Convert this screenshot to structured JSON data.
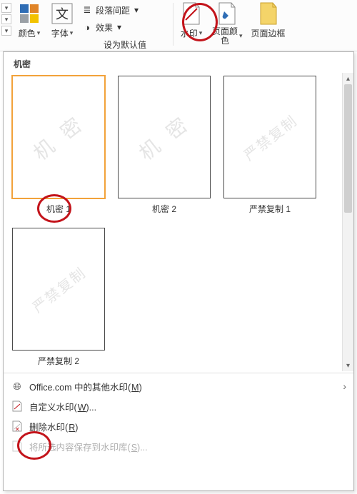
{
  "ribbon": {
    "color_label": "颜色",
    "font_label": "字体",
    "paragraph_spacing": "段落间距",
    "effects": "效果",
    "set_default": "设为默认值",
    "watermark": "水印",
    "page_color": "页面颜\n色",
    "page_border": "页面边框"
  },
  "panel": {
    "section_title": "机密",
    "items": [
      {
        "watermark_text": "机 密",
        "label": "机密 1",
        "selected": true
      },
      {
        "watermark_text": "机 密",
        "label": "机密 2",
        "selected": false
      },
      {
        "watermark_text": "严禁复制",
        "label": "严禁复制 1",
        "selected": false
      },
      {
        "watermark_text": "严禁复制",
        "label": "严禁复制 2",
        "selected": false
      }
    ],
    "menu": {
      "more_office": {
        "text": "Office.com 中的其他水印",
        "key": "M",
        "has_submenu": true
      },
      "custom": {
        "text": "自定义水印",
        "key": "W",
        "ellipsis": "..."
      },
      "remove": {
        "text": "删除水印",
        "key": "R"
      },
      "save_selection": {
        "text": "将所选内容保存到水印库",
        "key": "S",
        "ellipsis": "...",
        "disabled": true
      }
    }
  }
}
